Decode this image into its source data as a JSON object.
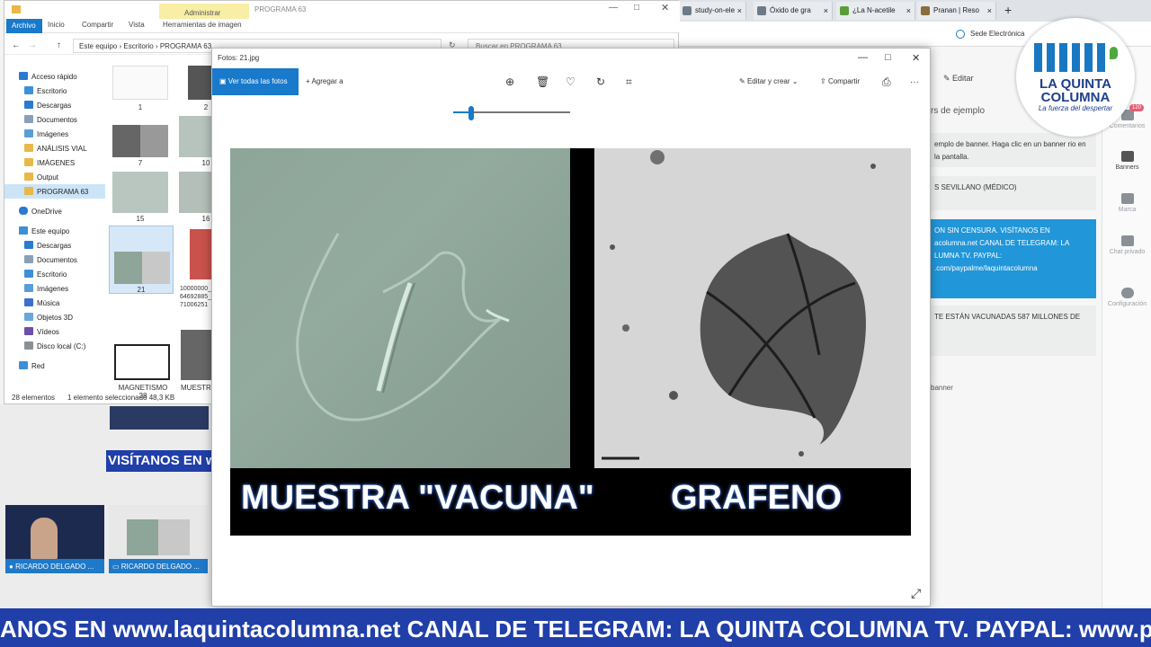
{
  "browser": {
    "tabs": [
      {
        "label": "study-on-ele"
      },
      {
        "label": "Óxido de gra"
      },
      {
        "label": "¿La N-acetile"
      },
      {
        "label": "Pranan | Reso"
      }
    ],
    "new_tab": "+",
    "bookmark": "Sede Electrónica"
  },
  "explorer": {
    "ribbon_tabs": [
      "Archivo",
      "Inicio",
      "Compartir",
      "Vista",
      "Herramientas de imagen"
    ],
    "manage_label": "Administrar",
    "window_title": "PROGRAMA 63",
    "address": [
      "Este equipo",
      "Escritorio",
      "PROGRAMA 63"
    ],
    "search_placeholder": "Buscar en PROGRAMA 63",
    "nav": [
      "Acceso rápido",
      "Escritorio",
      "Descargas",
      "Documentos",
      "Imágenes",
      "ANÁLISIS VIAL",
      "IMÁGENES",
      "Output",
      "PROGRAMA 63",
      "OneDrive",
      "Este equipo",
      "Descargas",
      "Documentos",
      "Escritorio",
      "Imágenes",
      "Música",
      "Objetos 3D",
      "Vídeos",
      "Disco local (C:)",
      "Red"
    ],
    "files": [
      "1",
      "2",
      "7",
      "10",
      "15",
      "16",
      "21",
      "10000000_964692885_471006251",
      "MAGNETISMO 28",
      "MUESTR"
    ],
    "status": {
      "count": "28 elementos",
      "selected": "1 elemento seleccionado  48,3 KB"
    }
  },
  "photos": {
    "title": "Fotos: 21.jpg",
    "see_all": "Ver todas las fotos",
    "add_to": "Agregar a",
    "edit_create": "Editar y crear",
    "share": "Compartir",
    "more": "···",
    "zoom_level": 0.15,
    "caption_left": "MUESTRA \"VACUNA\"",
    "caption_right": "GRAFENO"
  },
  "right_panel": {
    "edit": "Editar",
    "header": "rs de ejemplo",
    "card1": "emplo de banner. Haga clic en un banner rio en la pantalla.",
    "card2": "S SEVILLANO (MÉDICO)",
    "card3": "ON SIN CENSURA. VISÍTANOS EN acolumna.net CANAL DE TELEGRAM: LA LUMNA TV. PAYPAL: .com/paypalme/laquintacolumna",
    "card4": "TE ESTÁN VACUNADAS 587 MILLONES DE",
    "footer": "banner",
    "rail": [
      {
        "label": "Comentarios",
        "badge": "120"
      },
      {
        "label": "Banners"
      },
      {
        "label": "Marca"
      },
      {
        "label": "Chat privado"
      },
      {
        "label": "Configuración"
      }
    ]
  },
  "logo": {
    "title_line1": "LA QUINTA",
    "title_line2": "COLUMNA",
    "tagline": "La fuerza del despertar"
  },
  "stream": {
    "visitanos_small": "VISÍTANOS EN w",
    "cam1_label": "RICARDO DELGADO ...",
    "cam2_label": "RICARDO DELGADO ...",
    "ticker": "ANOS EN www.laquintacolumna.net CANAL DE TELEGRAM: LA QUINTA COLUMNA TV. PAYPAL: www.payp"
  },
  "colors": {
    "accent": "#1979ca",
    "banner": "#203fa9",
    "blue_card": "#2196d8"
  }
}
